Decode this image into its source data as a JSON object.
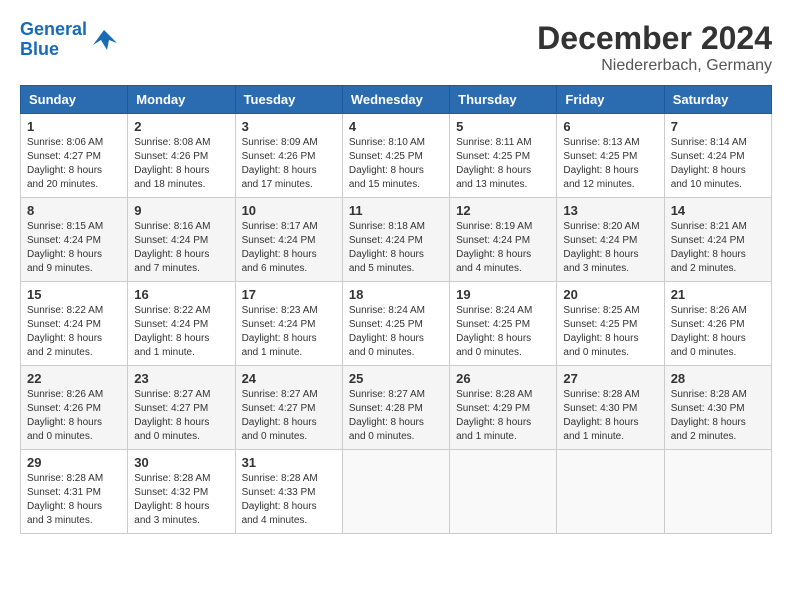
{
  "header": {
    "logo_line1": "General",
    "logo_line2": "Blue",
    "month": "December 2024",
    "location": "Niedererbach, Germany"
  },
  "weekdays": [
    "Sunday",
    "Monday",
    "Tuesday",
    "Wednesday",
    "Thursday",
    "Friday",
    "Saturday"
  ],
  "weeks": [
    [
      {
        "day": "1",
        "sunrise": "8:06 AM",
        "sunset": "4:27 PM",
        "daylight": "8 hours and 20 minutes."
      },
      {
        "day": "2",
        "sunrise": "8:08 AM",
        "sunset": "4:26 PM",
        "daylight": "8 hours and 18 minutes."
      },
      {
        "day": "3",
        "sunrise": "8:09 AM",
        "sunset": "4:26 PM",
        "daylight": "8 hours and 17 minutes."
      },
      {
        "day": "4",
        "sunrise": "8:10 AM",
        "sunset": "4:25 PM",
        "daylight": "8 hours and 15 minutes."
      },
      {
        "day": "5",
        "sunrise": "8:11 AM",
        "sunset": "4:25 PM",
        "daylight": "8 hours and 13 minutes."
      },
      {
        "day": "6",
        "sunrise": "8:13 AM",
        "sunset": "4:25 PM",
        "daylight": "8 hours and 12 minutes."
      },
      {
        "day": "7",
        "sunrise": "8:14 AM",
        "sunset": "4:24 PM",
        "daylight": "8 hours and 10 minutes."
      }
    ],
    [
      {
        "day": "8",
        "sunrise": "8:15 AM",
        "sunset": "4:24 PM",
        "daylight": "8 hours and 9 minutes."
      },
      {
        "day": "9",
        "sunrise": "8:16 AM",
        "sunset": "4:24 PM",
        "daylight": "8 hours and 7 minutes."
      },
      {
        "day": "10",
        "sunrise": "8:17 AM",
        "sunset": "4:24 PM",
        "daylight": "8 hours and 6 minutes."
      },
      {
        "day": "11",
        "sunrise": "8:18 AM",
        "sunset": "4:24 PM",
        "daylight": "8 hours and 5 minutes."
      },
      {
        "day": "12",
        "sunrise": "8:19 AM",
        "sunset": "4:24 PM",
        "daylight": "8 hours and 4 minutes."
      },
      {
        "day": "13",
        "sunrise": "8:20 AM",
        "sunset": "4:24 PM",
        "daylight": "8 hours and 3 minutes."
      },
      {
        "day": "14",
        "sunrise": "8:21 AM",
        "sunset": "4:24 PM",
        "daylight": "8 hours and 2 minutes."
      }
    ],
    [
      {
        "day": "15",
        "sunrise": "8:22 AM",
        "sunset": "4:24 PM",
        "daylight": "8 hours and 2 minutes."
      },
      {
        "day": "16",
        "sunrise": "8:22 AM",
        "sunset": "4:24 PM",
        "daylight": "8 hours and 1 minute."
      },
      {
        "day": "17",
        "sunrise": "8:23 AM",
        "sunset": "4:24 PM",
        "daylight": "8 hours and 1 minute."
      },
      {
        "day": "18",
        "sunrise": "8:24 AM",
        "sunset": "4:25 PM",
        "daylight": "8 hours and 0 minutes."
      },
      {
        "day": "19",
        "sunrise": "8:24 AM",
        "sunset": "4:25 PM",
        "daylight": "8 hours and 0 minutes."
      },
      {
        "day": "20",
        "sunrise": "8:25 AM",
        "sunset": "4:25 PM",
        "daylight": "8 hours and 0 minutes."
      },
      {
        "day": "21",
        "sunrise": "8:26 AM",
        "sunset": "4:26 PM",
        "daylight": "8 hours and 0 minutes."
      }
    ],
    [
      {
        "day": "22",
        "sunrise": "8:26 AM",
        "sunset": "4:26 PM",
        "daylight": "8 hours and 0 minutes."
      },
      {
        "day": "23",
        "sunrise": "8:27 AM",
        "sunset": "4:27 PM",
        "daylight": "8 hours and 0 minutes."
      },
      {
        "day": "24",
        "sunrise": "8:27 AM",
        "sunset": "4:27 PM",
        "daylight": "8 hours and 0 minutes."
      },
      {
        "day": "25",
        "sunrise": "8:27 AM",
        "sunset": "4:28 PM",
        "daylight": "8 hours and 0 minutes."
      },
      {
        "day": "26",
        "sunrise": "8:28 AM",
        "sunset": "4:29 PM",
        "daylight": "8 hours and 1 minute."
      },
      {
        "day": "27",
        "sunrise": "8:28 AM",
        "sunset": "4:30 PM",
        "daylight": "8 hours and 1 minute."
      },
      {
        "day": "28",
        "sunrise": "8:28 AM",
        "sunset": "4:30 PM",
        "daylight": "8 hours and 2 minutes."
      }
    ],
    [
      {
        "day": "29",
        "sunrise": "8:28 AM",
        "sunset": "4:31 PM",
        "daylight": "8 hours and 3 minutes."
      },
      {
        "day": "30",
        "sunrise": "8:28 AM",
        "sunset": "4:32 PM",
        "daylight": "8 hours and 3 minutes."
      },
      {
        "day": "31",
        "sunrise": "8:28 AM",
        "sunset": "4:33 PM",
        "daylight": "8 hours and 4 minutes."
      },
      null,
      null,
      null,
      null
    ]
  ],
  "labels": {
    "sunrise": "Sunrise:",
    "sunset": "Sunset:",
    "daylight": "Daylight:"
  }
}
